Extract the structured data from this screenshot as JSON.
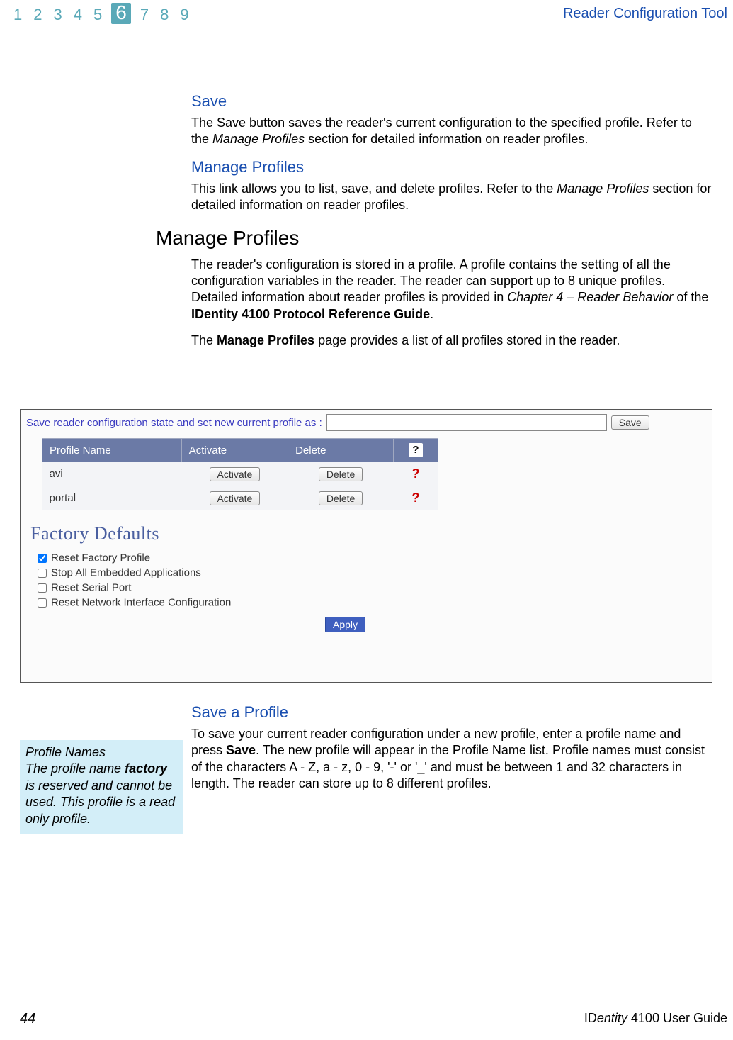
{
  "header": {
    "chapters": [
      "1",
      "2",
      "3",
      "4",
      "5",
      "6",
      "7",
      "8",
      "9"
    ],
    "current_index": 5,
    "title": "Reader Configuration Tool"
  },
  "sections": {
    "save": {
      "heading": "Save",
      "body_pre": "The Save button saves the reader's current configuration to the specified profile. Refer to the ",
      "body_em": "Manage Profiles",
      "body_post": " section for detailed information on reader profiles."
    },
    "manage_profiles_link": {
      "heading": "Manage Profiles",
      "body_pre": "This link allows you to list, save, and delete profiles. Refer to the ",
      "body_em": "Manage Profiles",
      "body_post": " section for detailed information on reader profiles."
    },
    "manage_profiles_main": {
      "heading": "Manage Profiles",
      "p1_pre": "The reader's configuration is stored in a profile. A profile contains the setting of all the configuration variables in the reader. The reader can support up to 8 unique profiles. Detailed information about reader profiles is provided in ",
      "p1_em": "Chapter 4 – Reader Behavior",
      "p1_mid": " of the ",
      "p1_bold": "IDentity 4100 Protocol Reference Guide",
      "p1_end": ".",
      "p2_pre": "The ",
      "p2_bold": "Manage Profiles",
      "p2_post": " page provides a list of all profiles stored in the reader."
    },
    "save_profile": {
      "heading": "Save a Profile",
      "body_pre": "To save your current reader configuration under a new profile, enter a profile name and press ",
      "body_bold": "Save",
      "body_post": ". The new profile will appear in the Profile Name list. Profile names must consist of the characters A - Z, a - z, 0 - 9, '-' or '_' and must be between 1 and 32 characters in length. The reader can store up to 8 different profiles."
    }
  },
  "ui": {
    "save_label": "Save reader configuration state and set new current profile as :",
    "save_button": "Save",
    "columns": {
      "name": "Profile Name",
      "activate": "Activate",
      "delete": "Delete"
    },
    "help_icon": "?",
    "rows": [
      {
        "name": "avi",
        "activate": "Activate",
        "delete": "Delete",
        "help": "?"
      },
      {
        "name": "portal",
        "activate": "Activate",
        "delete": "Delete",
        "help": "?"
      }
    ],
    "factory_heading": "Factory Defaults",
    "checks": [
      {
        "label": "Reset Factory Profile",
        "checked": true
      },
      {
        "label": "Stop All Embedded Applications",
        "checked": false
      },
      {
        "label": "Reset Serial Port",
        "checked": false
      },
      {
        "label": "Reset Network Interface Configuration",
        "checked": false
      }
    ],
    "apply_label": "Apply"
  },
  "sidebox": {
    "title": "Profile Names",
    "body_pre": "The profile name ",
    "body_bold": "factory",
    "body_post": " is reserved and cannot be used. This profile is a read only profile."
  },
  "footer": {
    "page": "44",
    "guide_pre": "ID",
    "guide_em": "entity",
    "guide_post": " 4100 User Guide"
  }
}
